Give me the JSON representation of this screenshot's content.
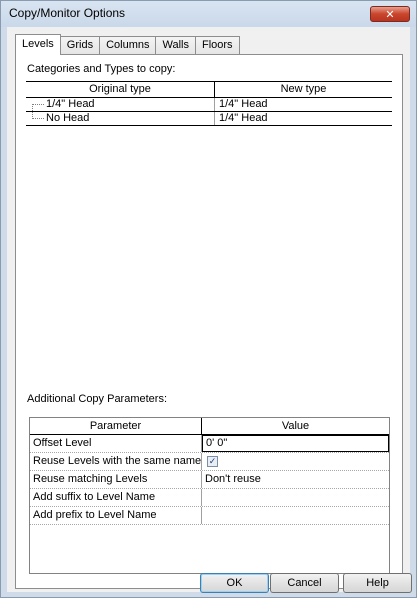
{
  "window": {
    "title": "Copy/Monitor Options",
    "close_label": "✕"
  },
  "tabs": [
    {
      "label": "Levels"
    },
    {
      "label": "Grids"
    },
    {
      "label": "Columns"
    },
    {
      "label": "Walls"
    },
    {
      "label": "Floors"
    }
  ],
  "categories": {
    "label": "Categories and Types to copy:",
    "headers": [
      "Original type",
      "New type"
    ],
    "rows": [
      {
        "original": "1/4\" Head",
        "new": "1/4\" Head"
      },
      {
        "original": "No Head",
        "new": "1/4\" Head"
      }
    ]
  },
  "additional": {
    "label": "Additional Copy Parameters:",
    "headers": [
      "Parameter",
      "Value"
    ],
    "rows": [
      {
        "param": "Offset Level",
        "value": "0'  0\""
      },
      {
        "param": "Reuse Levels with the same name",
        "value": "",
        "checked": true
      },
      {
        "param": "Reuse matching Levels",
        "value": "Don't reuse"
      },
      {
        "param": "Add suffix to Level Name",
        "value": ""
      },
      {
        "param": "Add prefix to Level Name",
        "value": ""
      }
    ]
  },
  "buttons": {
    "ok": "OK",
    "cancel": "Cancel",
    "help": "Help"
  },
  "icons": {
    "close": "close-icon",
    "check": "checkbox-checked-icon"
  }
}
